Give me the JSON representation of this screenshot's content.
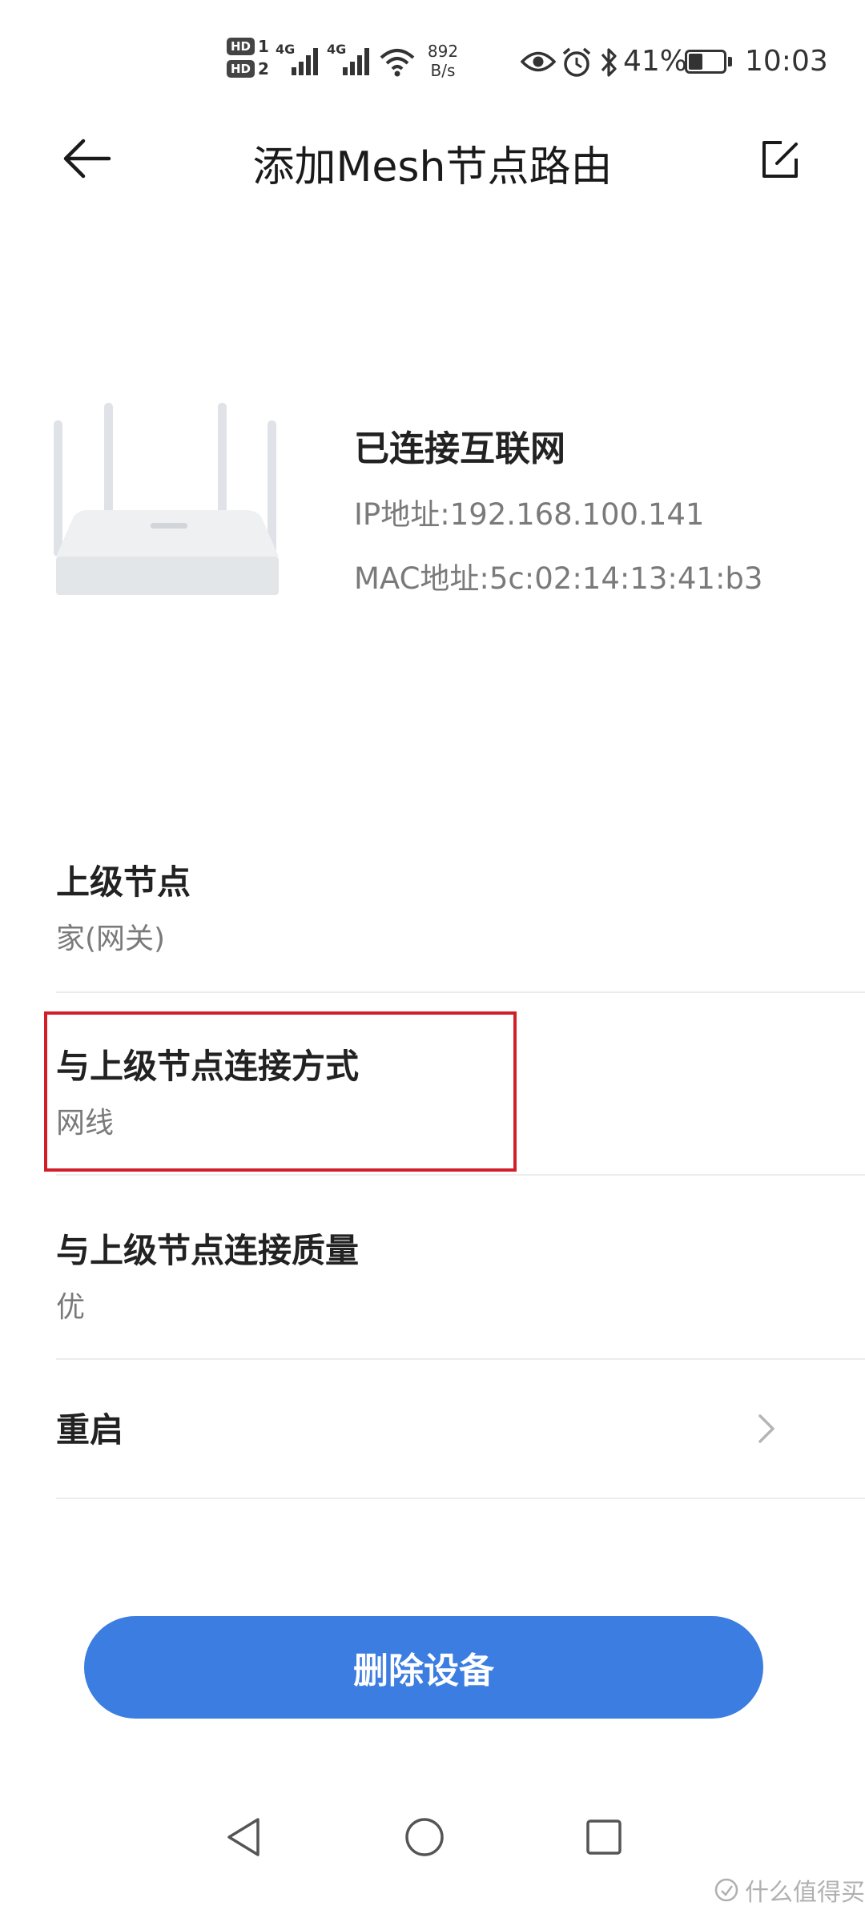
{
  "status_bar": {
    "hd1_badge": "HD",
    "hd1_num": "1",
    "hd2_badge": "HD",
    "hd2_num": "2",
    "net1": "4G",
    "net2": "4G",
    "speed_value": "892",
    "speed_unit": "B/s",
    "battery_percent": "41%",
    "battery_level": 0.41,
    "time": "10:03"
  },
  "header": {
    "title": "添加Mesh节点路由"
  },
  "device": {
    "status": "已连接互联网",
    "ip": "IP地址:192.168.100.141",
    "mac": "MAC地址:5c:02:14:13:41:b3"
  },
  "list": [
    {
      "title": "上级节点",
      "value": "家(网关)"
    },
    {
      "title": "与上级节点连接方式",
      "value": "网线"
    },
    {
      "title": "与上级节点连接质量",
      "value": "优"
    },
    {
      "title": "重启"
    }
  ],
  "actions": {
    "delete_label": "删除设备"
  },
  "watermark": "什么值得买",
  "colors": {
    "accent": "#3b7de0",
    "highlight": "#d11f2a"
  }
}
